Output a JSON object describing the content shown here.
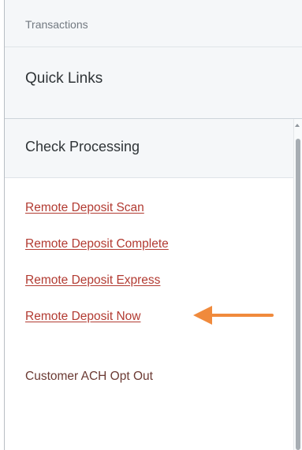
{
  "header": {
    "section_label": "Transactions",
    "quick_links_title": "Quick Links"
  },
  "check_processing": {
    "title": "Check Processing",
    "links": [
      {
        "label": "Remote Deposit Scan"
      },
      {
        "label": "Remote Deposit Complete"
      },
      {
        "label": "Remote Deposit Express"
      },
      {
        "label": "Remote Deposit Now"
      }
    ],
    "other_items": [
      {
        "label": "Customer ACH Opt Out"
      }
    ]
  },
  "annotation": {
    "arrow_color": "#f08a3c"
  },
  "colors": {
    "link": "#b23b32",
    "header_bg": "#f5f7f9",
    "text_dark": "#2f3437"
  },
  "icons": {
    "scroll_up": "triangle-up-icon",
    "annotation_arrow": "arrow-left-icon"
  }
}
